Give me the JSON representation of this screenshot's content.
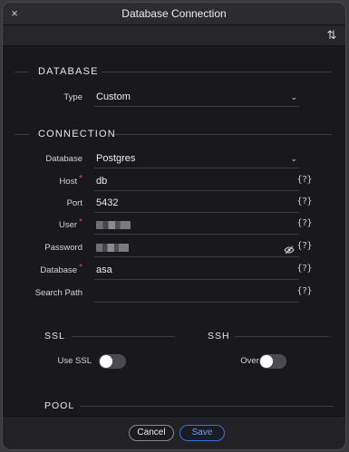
{
  "window": {
    "title": "Database Connection"
  },
  "toolbar": {
    "sort_icon": "sort-arrows-icon"
  },
  "database_section": {
    "title": "DATABASE",
    "type": {
      "label": "Type",
      "value": "Custom"
    }
  },
  "connection_section": {
    "title": "CONNECTION",
    "database_type": {
      "label": "Database",
      "value": "Postgres"
    },
    "host": {
      "label": "Host",
      "value": "db",
      "required": true
    },
    "port": {
      "label": "Port",
      "value": "5432"
    },
    "user": {
      "label": "User",
      "value": "",
      "required": true
    },
    "password": {
      "label": "Password",
      "value": ""
    },
    "database_name": {
      "label": "Database",
      "value": "asa",
      "required": true
    },
    "search_path": {
      "label": "Search Path",
      "value": ""
    },
    "variable_icon": "{?}"
  },
  "ssl": {
    "title": "SSL",
    "toggle_label": "Use SSL",
    "enabled": false
  },
  "ssh": {
    "title": "SSH",
    "toggle_label": "Over SSH",
    "enabled": false
  },
  "pool": {
    "title": "POOL"
  },
  "footer": {
    "cancel_label": "Cancel",
    "save_label": "Save"
  },
  "colors": {
    "accent": "#3f6fd8",
    "required": "#e24a4a",
    "background": "#19191d"
  }
}
